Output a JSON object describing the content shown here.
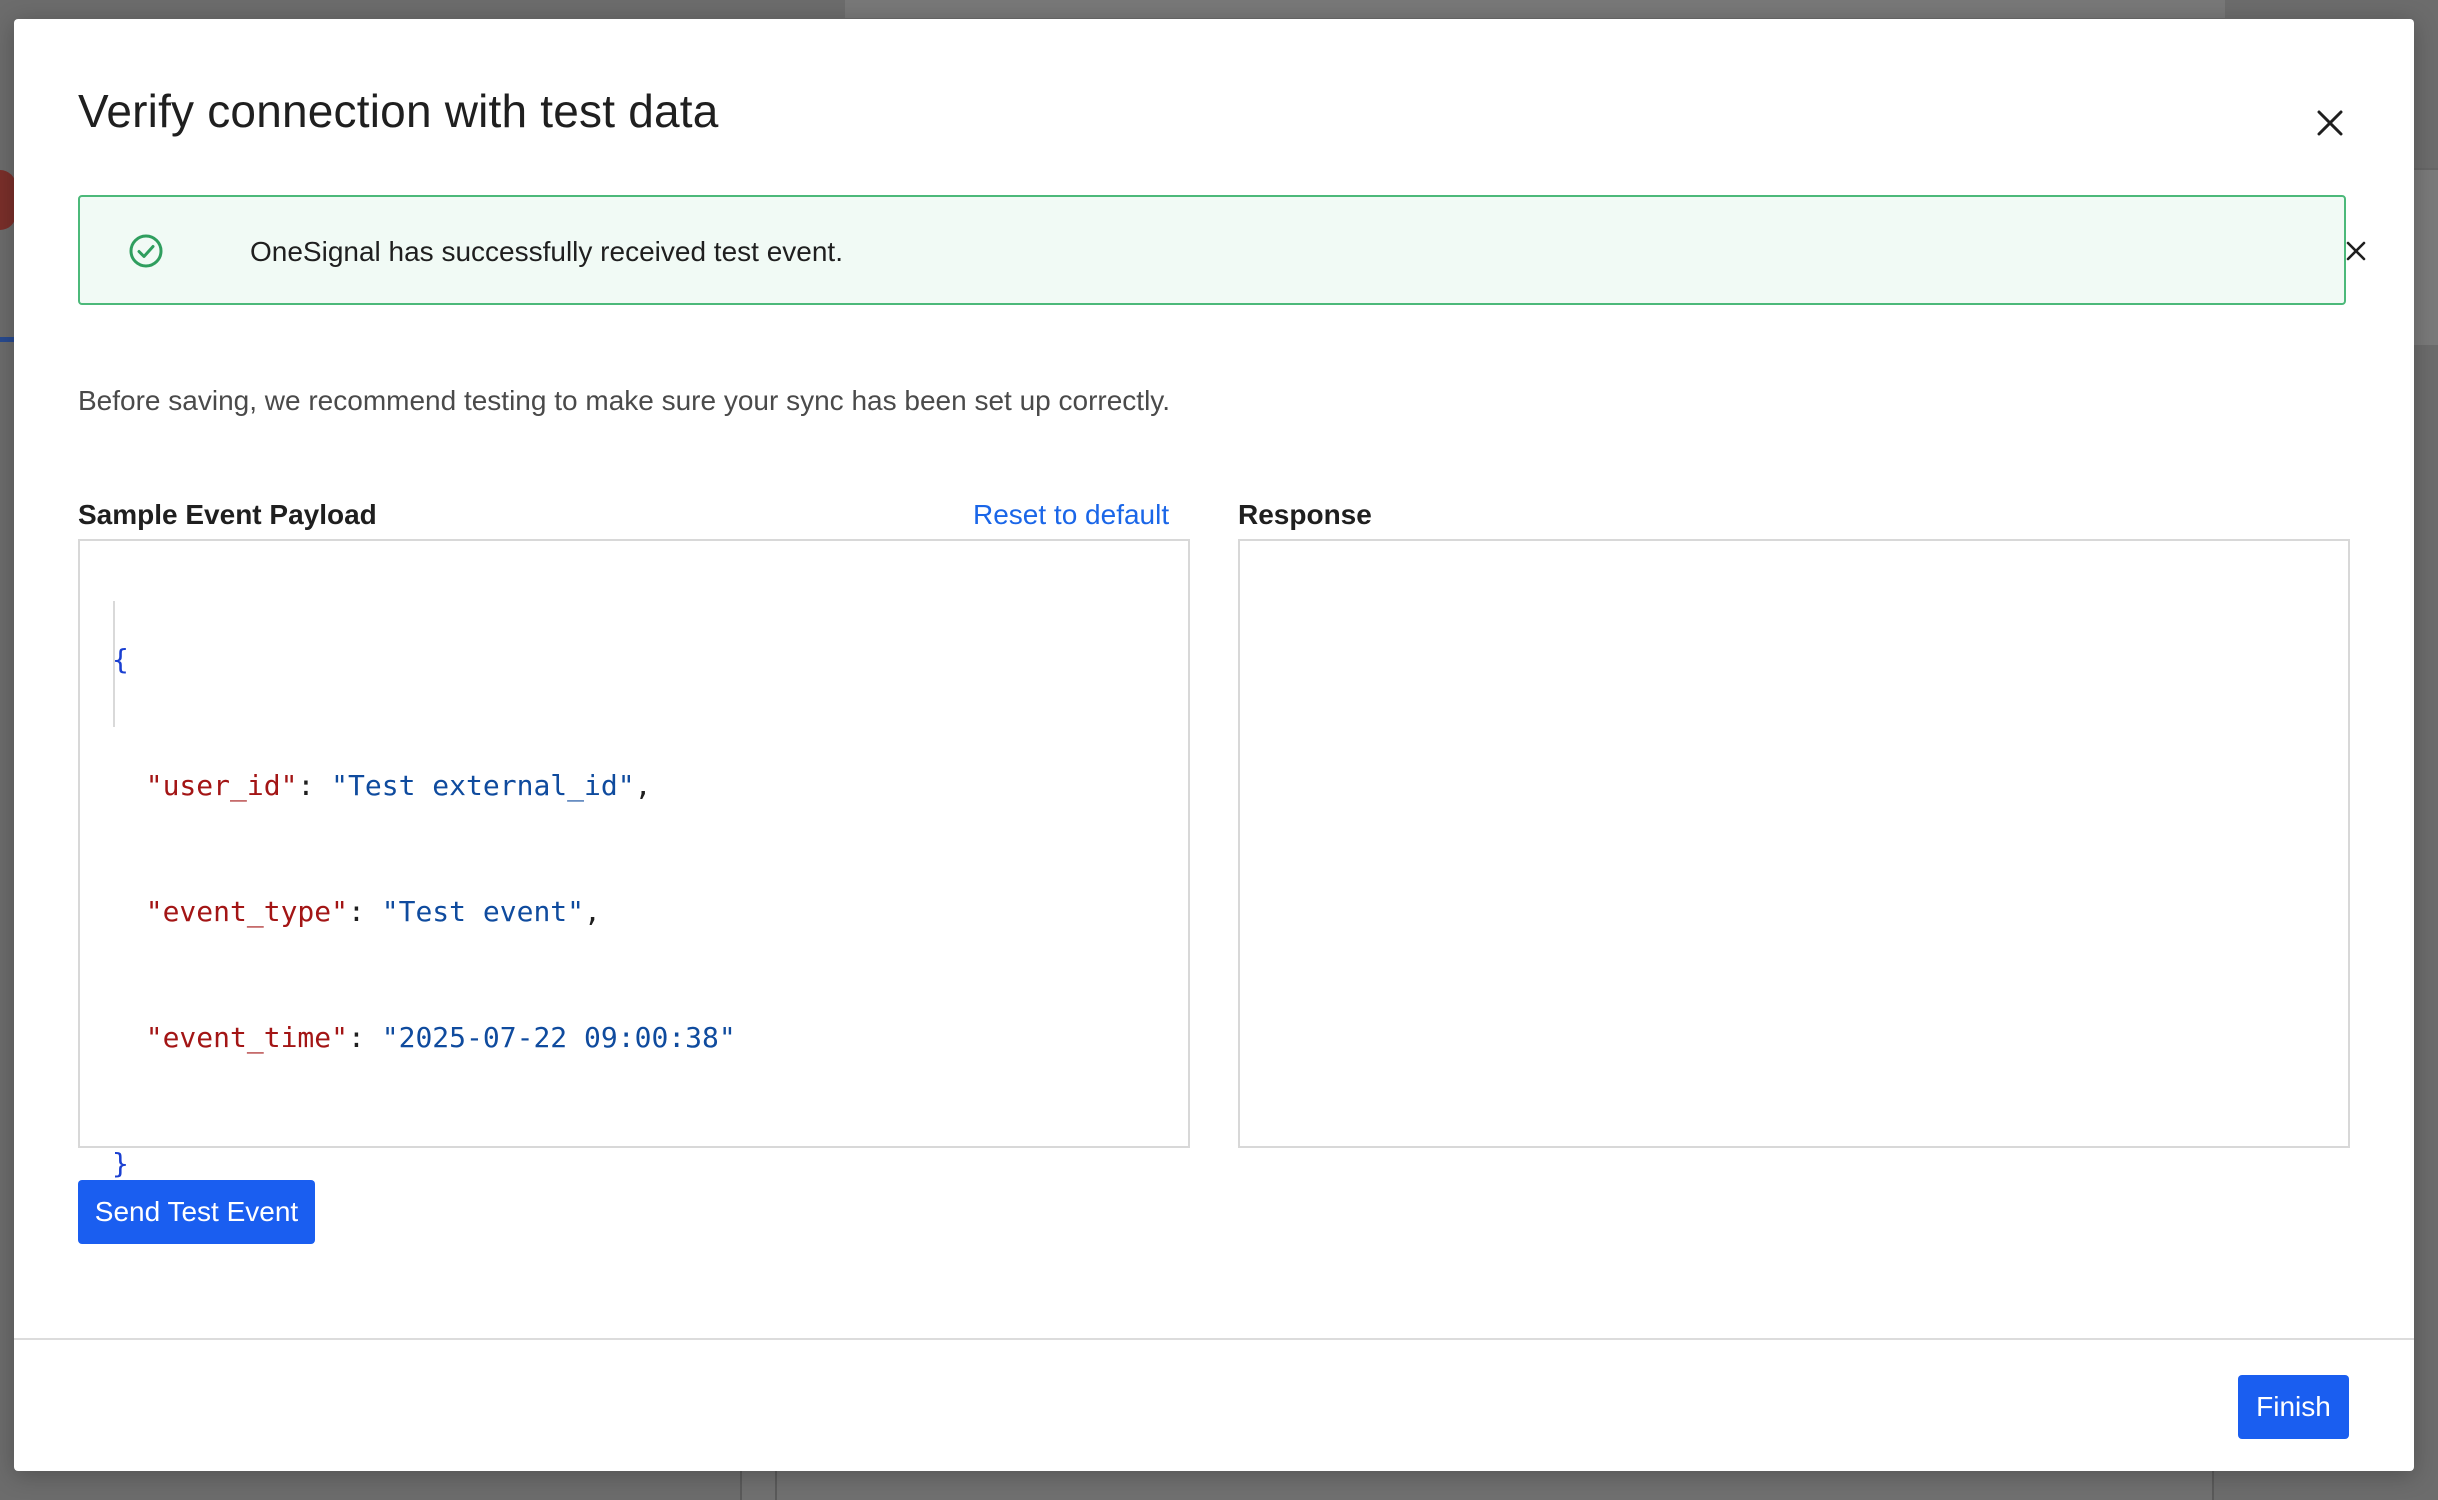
{
  "modal": {
    "title": "Verify connection with test data",
    "close_icon": "close-icon"
  },
  "alert": {
    "status": "success",
    "icon": "check-circle-icon",
    "message": "OneSignal has successfully received test event.",
    "close_icon": "close-icon",
    "color_border": "#4cb97a",
    "color_background": "#f1faf5"
  },
  "intro": {
    "text": "Before saving, we recommend testing to make sure your sync has been set up correctly."
  },
  "payload": {
    "label": "Sample Event Payload",
    "reset_label": "Reset to default",
    "open_brace": "{",
    "close_brace": "}",
    "fields": [
      {
        "key": "\"user_id\"",
        "value": "\"Test external_id\"",
        "trailing": ","
      },
      {
        "key": "\"event_type\"",
        "value": "\"Test event\"",
        "trailing": ","
      },
      {
        "key": "\"event_time\"",
        "value": "\"2025-07-22 09:00:38\"",
        "trailing": ""
      }
    ]
  },
  "response": {
    "label": "Response",
    "content": ""
  },
  "actions": {
    "send_label": "Send Test Event",
    "finish_label": "Finish"
  },
  "colors": {
    "primary": "#1a5ef0",
    "link": "#1a66e8",
    "json_key": "#a31515",
    "json_string": "#0f4b9e",
    "json_brace": "#1a3fd1"
  }
}
